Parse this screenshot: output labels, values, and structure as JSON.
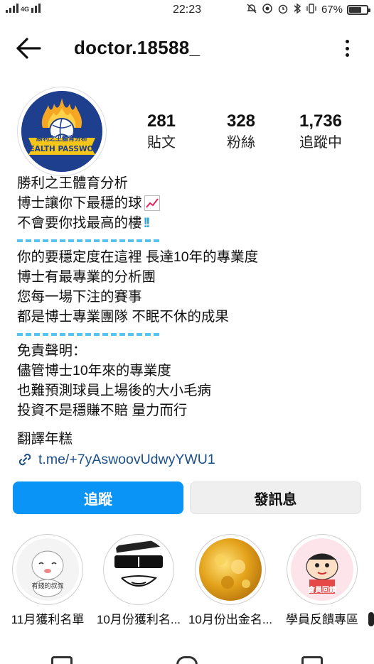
{
  "status_bar": {
    "network": "4G",
    "time": "22:23",
    "battery": "67%",
    "icons": [
      "mute-icon",
      "data-saver-icon",
      "alarm-icon",
      "bluetooth-icon",
      "vibrate-icon"
    ]
  },
  "header": {
    "username": "doctor.18588_",
    "back_icon": "arrow-left-icon",
    "more_icon": "more-vertical-icon"
  },
  "profile": {
    "avatar_text_top": "勝利之王體育分析",
    "avatar_text_bottom": "WEALTH PASSWORD",
    "stats": [
      {
        "value": "281",
        "label": "貼文"
      },
      {
        "value": "328",
        "label": "粉絲"
      },
      {
        "value": "1,736",
        "label": "追蹤中"
      }
    ]
  },
  "bio": {
    "name": "勝利之王體育分析",
    "line1": "博士讓你下最穩的球",
    "line2": "不會要你找最高的樓",
    "para1": [
      "你的要穩定度在這裡 長達10年的專業度",
      "博士有最專業的分析團",
      "您每一場下注的賽事",
      "都是博士專業團隊 不眠不休的成果"
    ],
    "para2": [
      "免責聲明：",
      "儘管博士10年來的專業度",
      "也難預測球員上場後的大小毛病",
      "投資不是穩賺不賠 量力而行"
    ],
    "translate": "翻譯年糕",
    "link": "t.me/+7yAswoovUdwyYWU1",
    "link_icon": "link-icon",
    "divider_color": "#56c3f0"
  },
  "actions": {
    "follow": "追蹤",
    "message": "發訊息",
    "follow_color": "#0a95f6"
  },
  "highlights": [
    {
      "label": "11月獲利名單",
      "sticker_text": "有錢的叔叔"
    },
    {
      "label": "10月份獲利名..."
    },
    {
      "label": "10月份出金名..."
    },
    {
      "label": "學員反饋專區",
      "sticker_text": "會員回饋"
    }
  ]
}
